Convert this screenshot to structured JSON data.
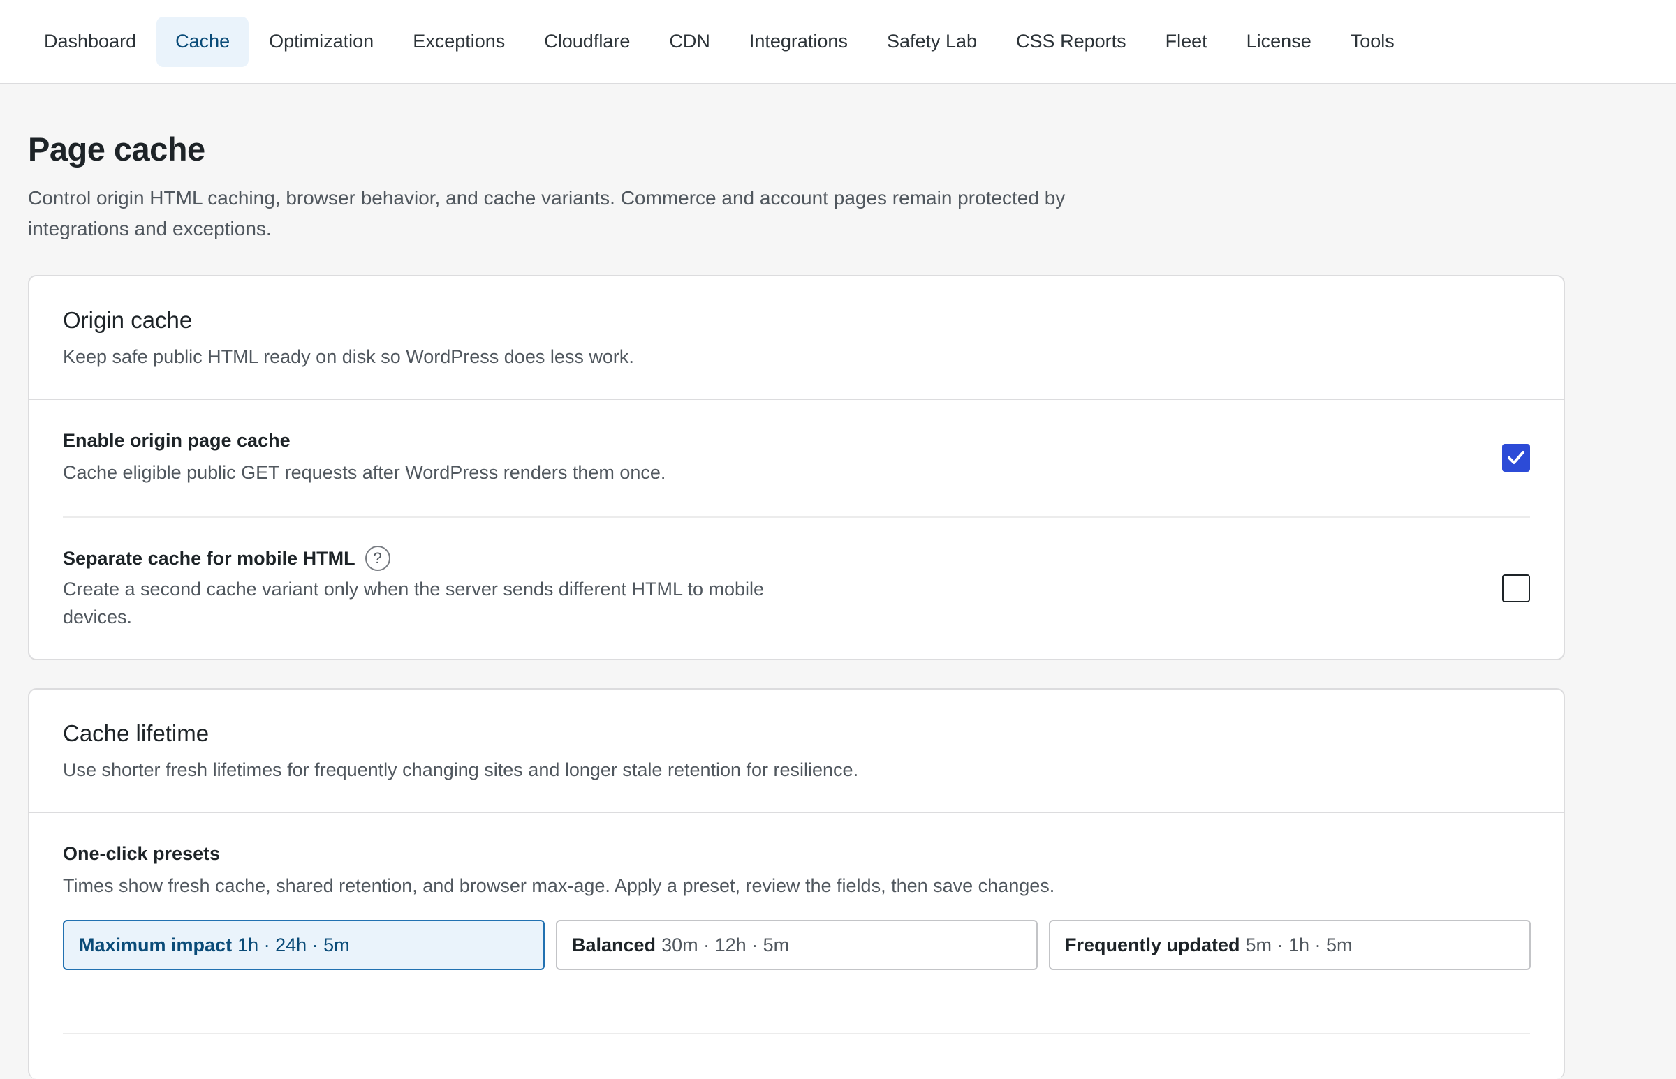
{
  "nav": {
    "tabs": [
      {
        "label": "Dashboard"
      },
      {
        "label": "Cache"
      },
      {
        "label": "Optimization"
      },
      {
        "label": "Exceptions"
      },
      {
        "label": "Cloudflare"
      },
      {
        "label": "CDN"
      },
      {
        "label": "Integrations"
      },
      {
        "label": "Safety Lab"
      },
      {
        "label": "CSS Reports"
      },
      {
        "label": "Fleet"
      },
      {
        "label": "License"
      },
      {
        "label": "Tools"
      }
    ],
    "active_tab": "Cache"
  },
  "page": {
    "title": "Page cache",
    "description": "Control origin HTML caching, browser behavior, and cache variants. Commerce and account pages remain protected by integrations and exceptions."
  },
  "origin_cache": {
    "title": "Origin cache",
    "subtitle": "Keep safe public HTML ready on disk so WordPress does less work.",
    "settings": [
      {
        "label": "Enable origin page cache",
        "description": "Cache eligible public GET requests after WordPress renders them once.",
        "checked": true
      },
      {
        "label": "Separate cache for mobile HTML",
        "help": "?",
        "description": "Create a second cache variant only when the server sends different HTML to mobile devices.",
        "checked": false
      }
    ]
  },
  "cache_lifetime": {
    "title": "Cache lifetime",
    "subtitle": "Use shorter fresh lifetimes for frequently changing sites and longer stale retention for resilience.",
    "presets_label": "One-click presets",
    "presets_desc": "Times show fresh cache, shared retention, and browser max-age. Apply a preset, review the fields, then save changes.",
    "presets": [
      {
        "name": "Maximum impact",
        "times": "1h · 24h · 5m",
        "active": true
      },
      {
        "name": "Balanced",
        "times": "30m · 12h · 5m",
        "active": false
      },
      {
        "name": "Frequently updated",
        "times": "5m · 1h · 5m",
        "active": false
      }
    ]
  },
  "colors": {
    "accent": "#2c4bd7",
    "active_tab_bg": "#eaf3fb",
    "active_tab_text": "#0a4b78",
    "preset_active_border": "#2271b1"
  }
}
